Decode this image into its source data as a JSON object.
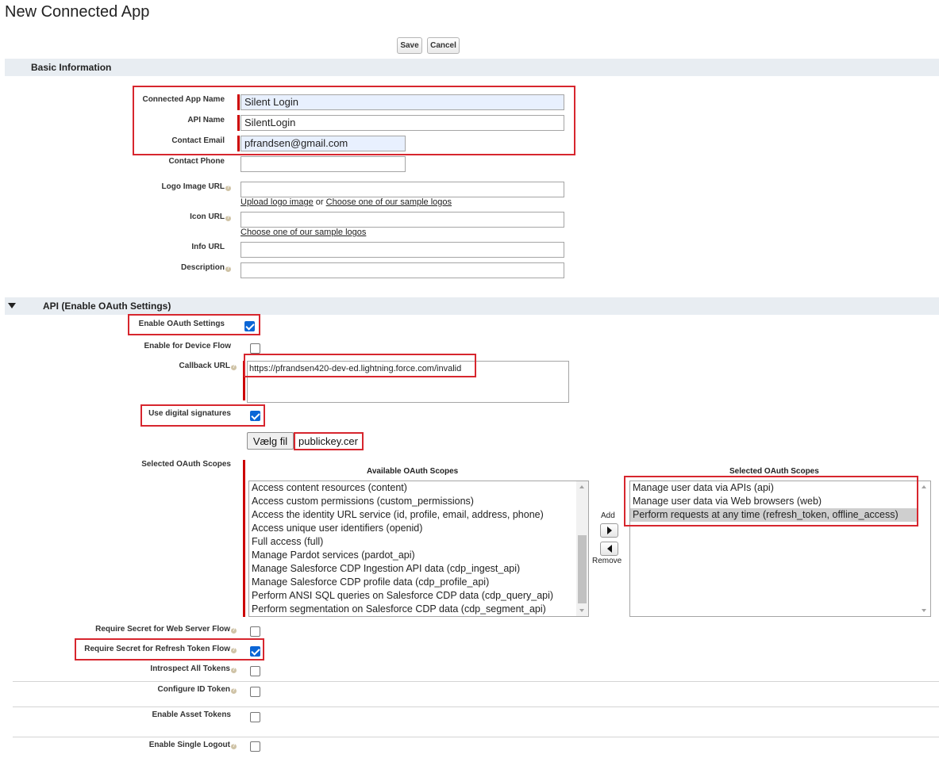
{
  "page": {
    "title": "New Connected App"
  },
  "toolbar": {
    "save_label": "Save",
    "cancel_label": "Cancel"
  },
  "basic": {
    "title": "Basic Information",
    "app_name_label": "Connected App Name",
    "app_name_value": "Silent Login",
    "api_name_label": "API Name",
    "api_name_value": "SilentLogin",
    "email_label": "Contact Email",
    "email_value": "pfrandsen@gmail.com",
    "phone_label": "Contact Phone",
    "phone_value": "",
    "logo_label": "Logo Image URL",
    "logo_value": "",
    "upload_logo_link": "Upload logo image",
    "or_text": "or",
    "choose_logo_link": "Choose one of our sample logos",
    "icon_label": "Icon URL",
    "icon_value": "",
    "choose_icon_link": "Choose one of our sample logos",
    "info_label": "Info URL",
    "info_value": "",
    "desc_label": "Description",
    "desc_value": ""
  },
  "api": {
    "title": "API (Enable OAuth Settings)",
    "enable_oauth_label": "Enable OAuth Settings",
    "enable_oauth_checked": true,
    "device_flow_label": "Enable for Device Flow",
    "device_flow_checked": false,
    "callback_label": "Callback URL",
    "callback_value": "https://pfrandsen420-dev-ed.lightning.force.com/invalid",
    "digital_sig_label": "Use digital signatures",
    "digital_sig_checked": true,
    "choose_file_label": "Vælg fil",
    "file_name": "publickey.cer",
    "scopes_label": "Selected OAuth Scopes",
    "available_header": "Available OAuth Scopes",
    "selected_header": "Selected OAuth Scopes",
    "available_scopes": [
      "Access content resources (content)",
      "Access custom permissions (custom_permissions)",
      "Access the identity URL service (id, profile, email, address, phone)",
      "Access unique user identifiers (openid)",
      "Full access (full)",
      "Manage Pardot services (pardot_api)",
      "Manage Salesforce CDP Ingestion API data (cdp_ingest_api)",
      "Manage Salesforce CDP profile data (cdp_profile_api)",
      "Perform ANSI SQL queries on Salesforce CDP data (cdp_query_api)",
      "Perform segmentation on Salesforce CDP data (cdp_segment_api)"
    ],
    "selected_scopes": [
      "Manage user data via APIs (api)",
      "Manage user data via Web browsers (web)",
      "Perform requests at any time (refresh_token, offline_access)"
    ],
    "add_label": "Add",
    "remove_label": "Remove",
    "secret_web_label": "Require Secret for Web Server Flow",
    "secret_web_checked": false,
    "secret_refresh_label": "Require Secret for Refresh Token Flow",
    "secret_refresh_checked": true,
    "introspect_label": "Introspect All Tokens",
    "introspect_checked": false,
    "id_token_label": "Configure ID Token",
    "id_token_checked": false,
    "asset_tokens_label": "Enable Asset Tokens",
    "asset_tokens_checked": false,
    "single_logout_label": "Enable Single Logout",
    "single_logout_checked": false
  },
  "colors": {
    "highlight": "#d7262e",
    "required": "#cc0000",
    "checkbox": "#0b66d6",
    "section_bar": "#e8edf2"
  },
  "icons": {
    "help": "help-icon",
    "collapse": "triangle-down-icon",
    "add": "arrow-right-icon",
    "remove": "arrow-left-icon"
  }
}
